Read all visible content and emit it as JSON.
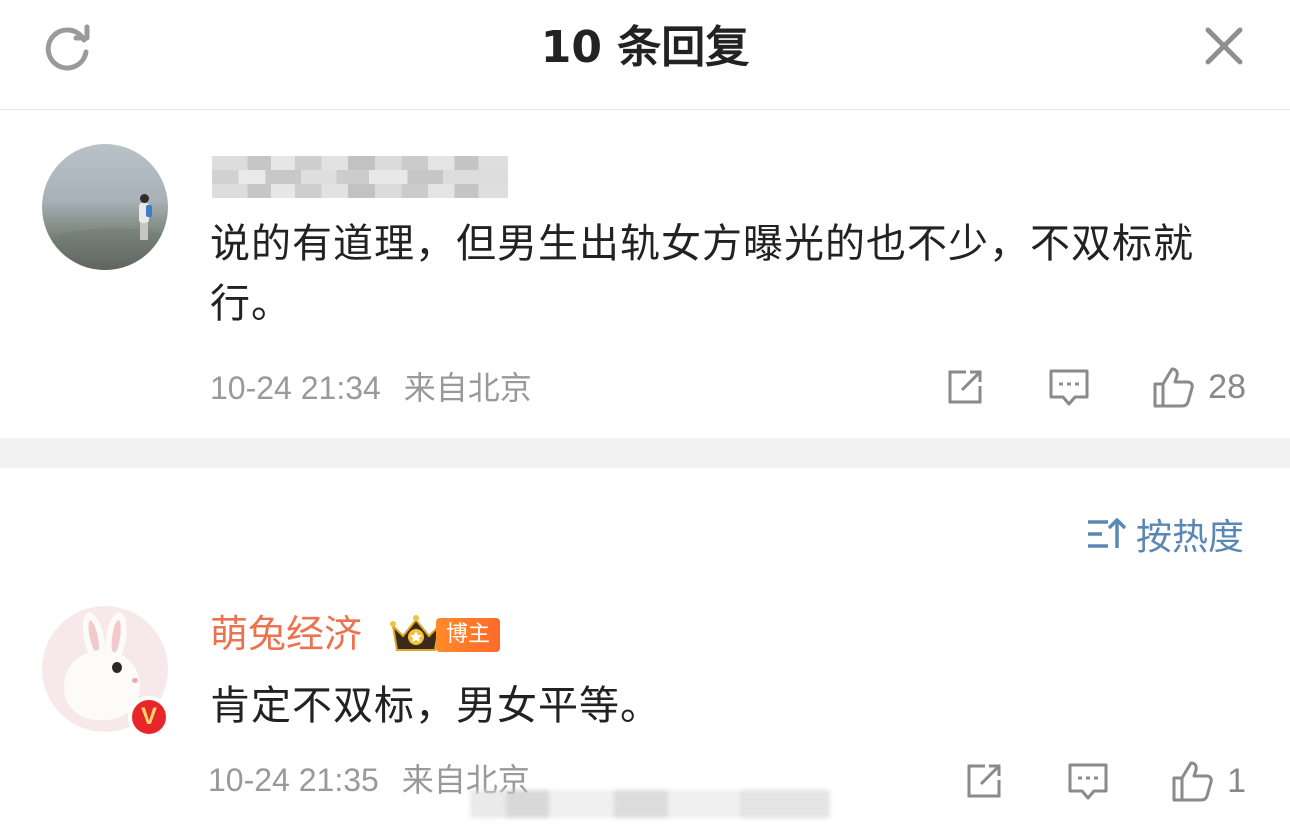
{
  "header": {
    "title": "10 条回复",
    "refresh_icon": "refresh-icon",
    "close_icon": "close-icon"
  },
  "comments": [
    {
      "username": "",
      "username_blurred": true,
      "text": "说的有道理，但男生出轨女方曝光的也不少，不双标就行。",
      "time": "10-24 21:34",
      "location": "来自北京",
      "likes": "28",
      "icons": [
        "share-icon",
        "reply-icon",
        "like-icon"
      ]
    },
    {
      "username": "萌兔经济",
      "badge": "博主",
      "verified": "V",
      "text": "肯定不双标，男女平等。",
      "time": "10-24 21:35",
      "location": "来自北京",
      "likes": "1",
      "icons": [
        "share-icon",
        "reply-icon",
        "like-icon"
      ]
    }
  ],
  "sort": {
    "label": "按热度",
    "icon": "sort-icon"
  },
  "colors": {
    "username": "#eb7350",
    "link": "#5a87b3",
    "meta": "#999999",
    "badge": "#ff7a2a",
    "verified": "#e8262a"
  }
}
